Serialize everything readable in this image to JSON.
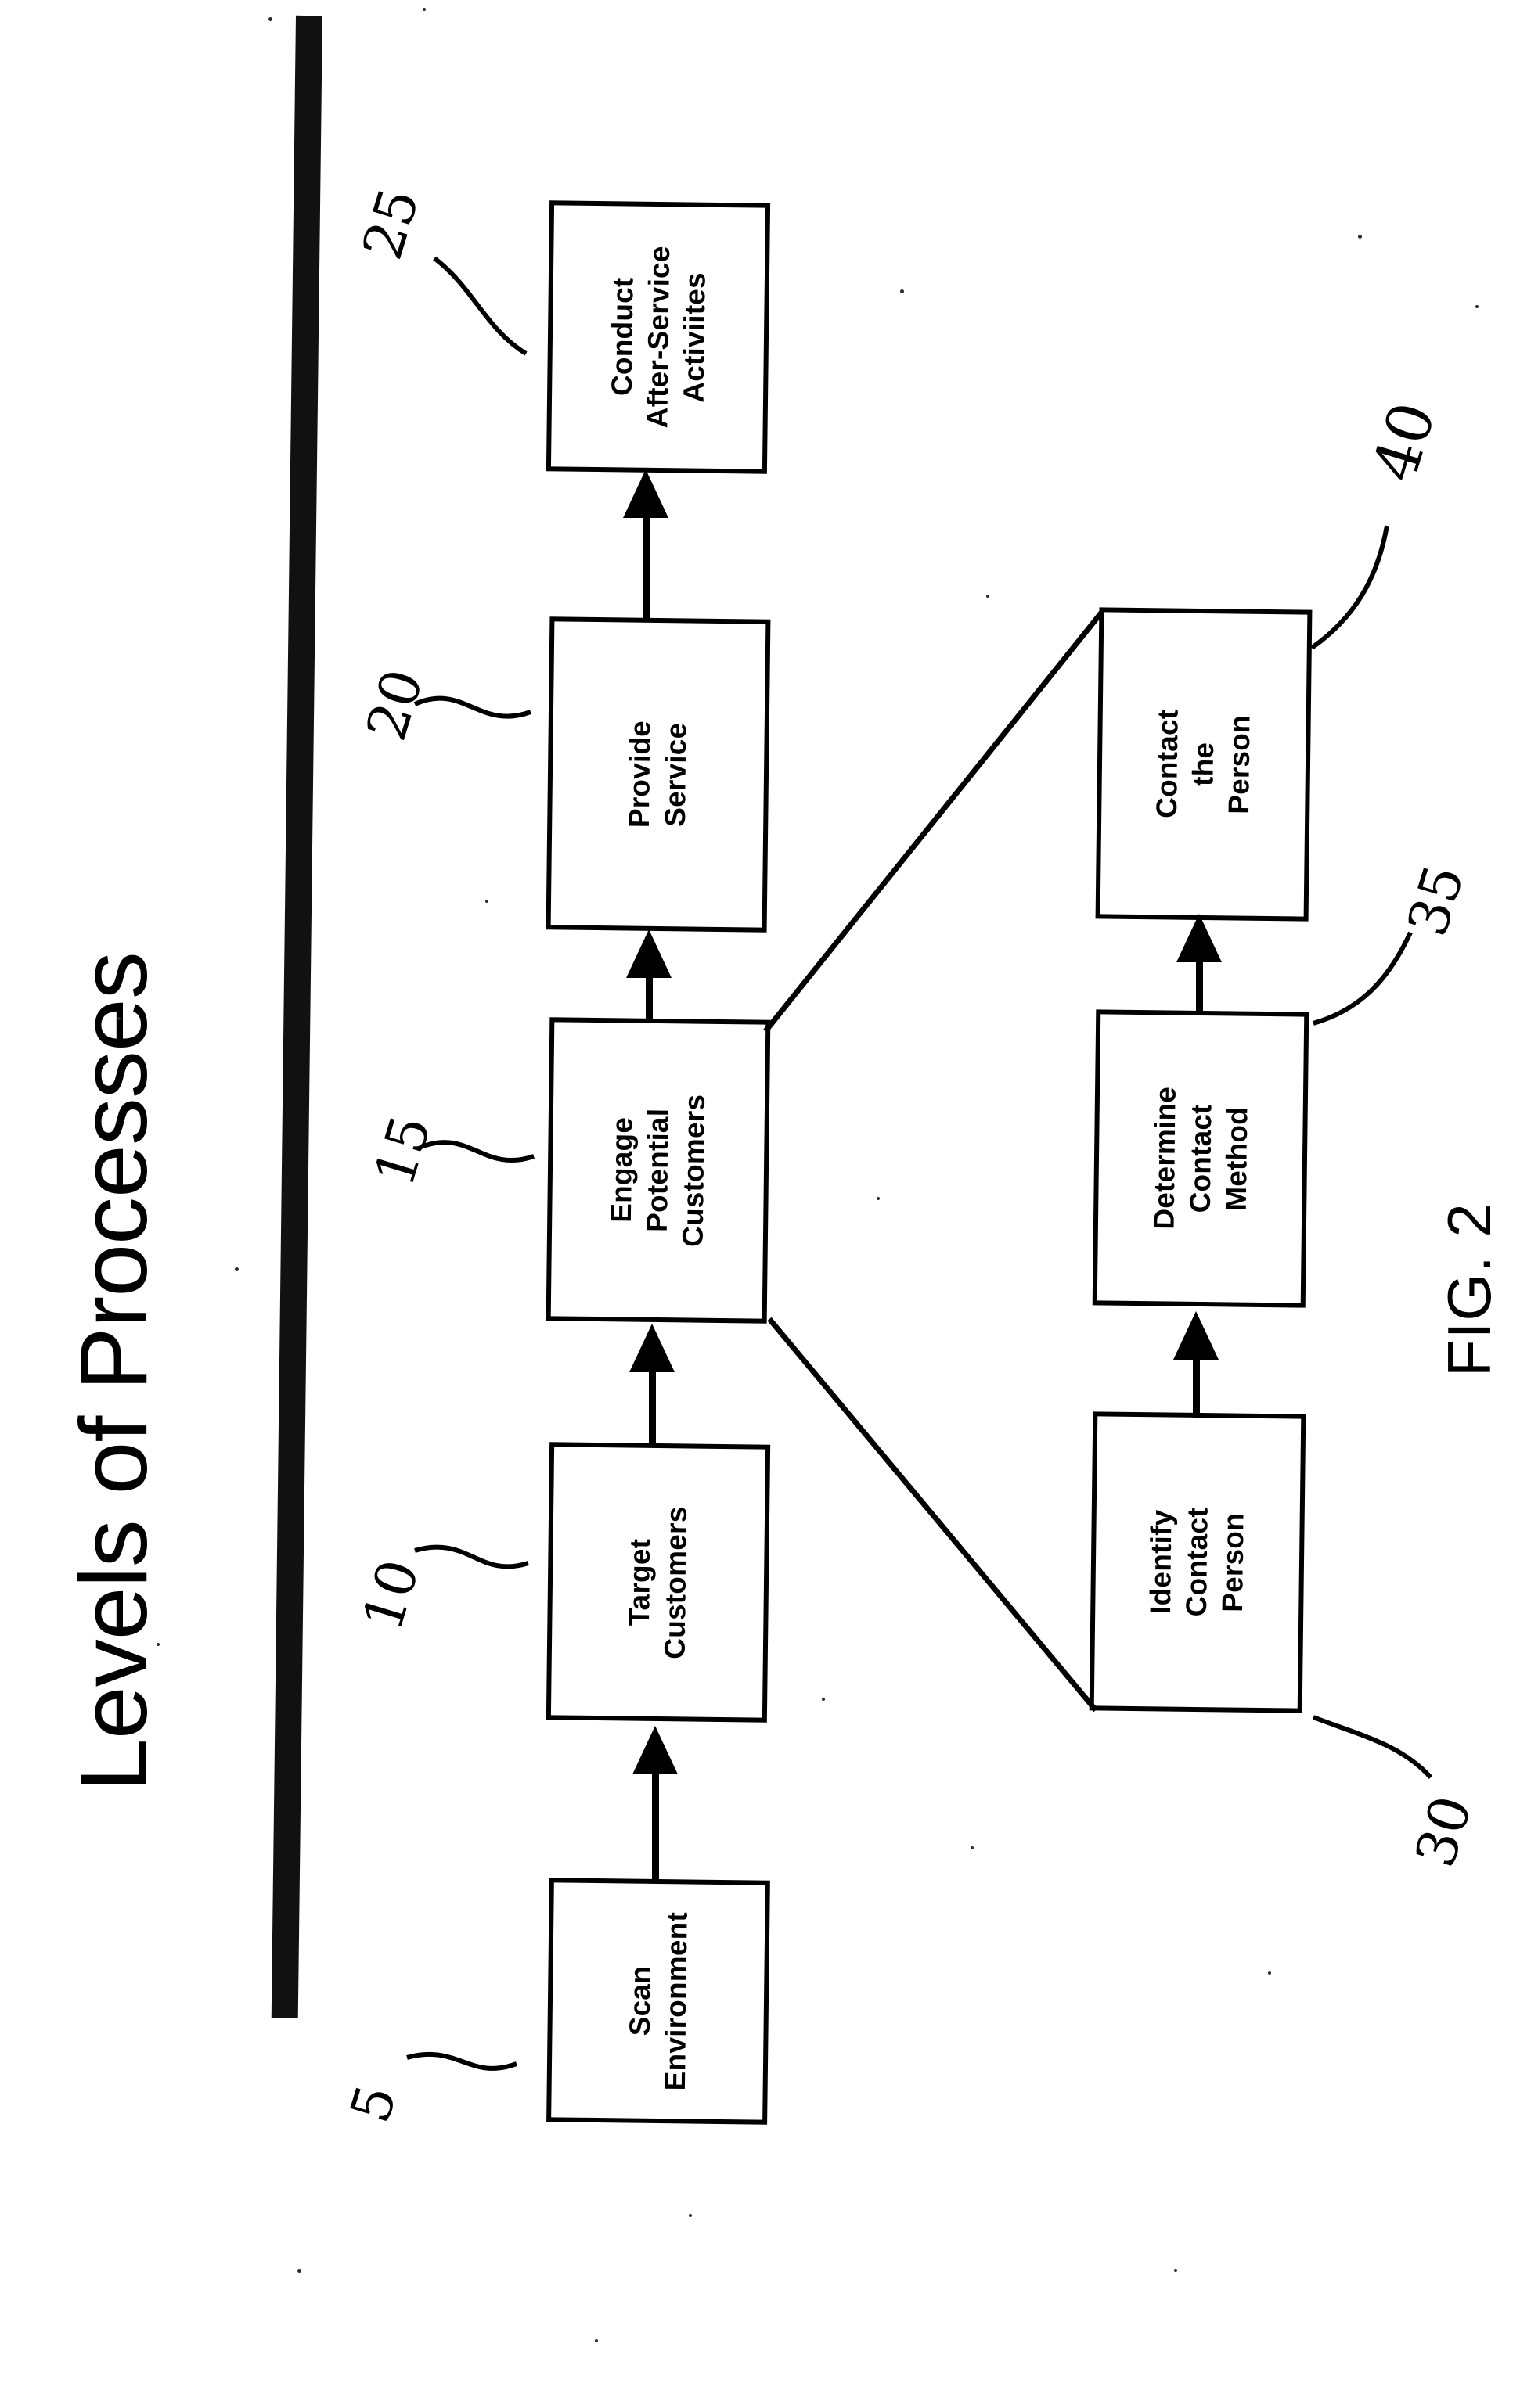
{
  "figure": {
    "title": "Levels of Processes",
    "fig_label": "FIG. 2",
    "background_color": "#ffffff",
    "ink_color": "#000000"
  },
  "axis": {
    "name": "levels-of-processes-axis",
    "orientation": "vertical-bar"
  },
  "top_level_process": {
    "boxes": [
      {
        "id": "scan-environment",
        "lines": [
          "Scan",
          "Environment"
        ],
        "ref": "5"
      },
      {
        "id": "target-customers",
        "lines": [
          "Target",
          "Customers"
        ],
        "ref": "10"
      },
      {
        "id": "engage-potential-customers",
        "lines": [
          "Engage",
          "Potential",
          "Customers"
        ],
        "ref": "15"
      },
      {
        "id": "provide-service",
        "lines": [
          "Provide",
          "Service"
        ],
        "ref": "20"
      },
      {
        "id": "conduct-after-service",
        "lines": [
          "Conduct",
          "After-Service",
          "Activiites"
        ],
        "ref": "25"
      }
    ]
  },
  "sub_level_process": {
    "boxes": [
      {
        "id": "identify-contact-person",
        "lines": [
          "Identify",
          "Contact",
          "Person"
        ],
        "ref": "30"
      },
      {
        "id": "determine-contact-method",
        "lines": [
          "Determine",
          "Contact",
          "Method"
        ],
        "ref": "35"
      },
      {
        "id": "contact-the-person",
        "lines": [
          "Contact",
          "the",
          "Person"
        ],
        "ref": "40"
      }
    ]
  },
  "reference_numerals": [
    "5",
    "10",
    "15",
    "20",
    "25",
    "30",
    "35",
    "40"
  ],
  "chart_data": {
    "type": "diagram",
    "title": "Levels of Processes",
    "subtitle": "FIG. 2",
    "nodes": [
      {
        "id": "5",
        "label": "Scan Environment",
        "level": "top"
      },
      {
        "id": "10",
        "label": "Target Customers",
        "level": "top"
      },
      {
        "id": "15",
        "label": "Engage Potential Customers",
        "level": "top"
      },
      {
        "id": "20",
        "label": "Provide Service",
        "level": "top"
      },
      {
        "id": "25",
        "label": "Conduct After-Service Activiites",
        "level": "top"
      },
      {
        "id": "30",
        "label": "Identify Contact Person",
        "level": "sub"
      },
      {
        "id": "35",
        "label": "Determine Contact Method",
        "level": "sub"
      },
      {
        "id": "40",
        "label": "Contact the Person",
        "level": "sub"
      }
    ],
    "edges": [
      {
        "from": "5",
        "to": "10",
        "kind": "arrow"
      },
      {
        "from": "10",
        "to": "15",
        "kind": "arrow"
      },
      {
        "from": "15",
        "to": "20",
        "kind": "arrow"
      },
      {
        "from": "20",
        "to": "25",
        "kind": "arrow"
      },
      {
        "from": "30",
        "to": "35",
        "kind": "arrow"
      },
      {
        "from": "35",
        "to": "40",
        "kind": "arrow"
      },
      {
        "from": "15",
        "to": "30",
        "kind": "decomposition"
      },
      {
        "from": "15",
        "to": "40",
        "kind": "decomposition"
      }
    ]
  }
}
